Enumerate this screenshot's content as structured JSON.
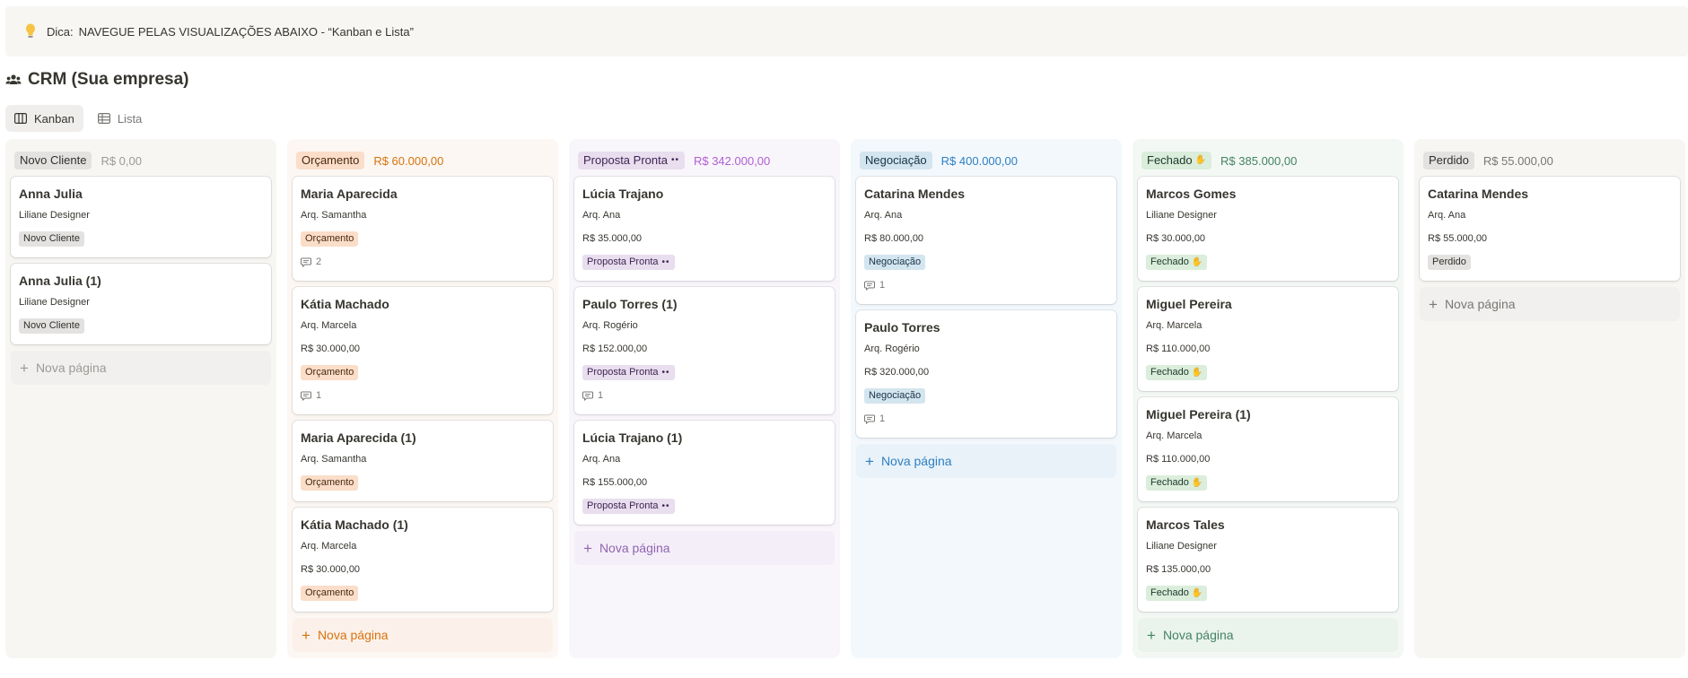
{
  "tip": {
    "label": "Dica:",
    "text": "NAVEGUE PELAS VISUALIZAÇÕES ABAIXO - “Kanban e Lista”"
  },
  "page": {
    "title": "CRM (Sua empresa)"
  },
  "views": [
    {
      "label": "Kanban"
    },
    {
      "label": "Lista"
    }
  ],
  "columns": [
    {
      "label": "Novo Cliente",
      "total": "R$ 0,00",
      "colors": {
        "bg": "#f7f6f3",
        "pill": "#e3e2e0",
        "pill_text": "#32302c",
        "total": "#9b9a97",
        "new": "#9b9a97",
        "newbg": "#f1f0ee"
      },
      "cards": [
        {
          "name": "Anna Julia",
          "sub": "Liliane Designer",
          "tag": "Novo Cliente"
        },
        {
          "name": "Anna Julia (1)",
          "sub": "Liliane Designer",
          "tag": "Novo Cliente"
        }
      ],
      "new_label": "Nova página"
    },
    {
      "label": "Orçamento",
      "total": "R$ 60.000,00",
      "colors": {
        "bg": "#fcf7f3",
        "pill": "#fadec9",
        "pill_text": "#49290e",
        "total": "#d9730d",
        "new": "#d9730d",
        "newbg": "#fbf1ea"
      },
      "cards": [
        {
          "name": "Maria Aparecida",
          "sub": "Arq. Samantha",
          "tag": "Orçamento",
          "comments": "2"
        },
        {
          "name": "Kátia Machado",
          "sub": "Arq. Marcela",
          "value": "R$ 30.000,00",
          "tag": "Orçamento",
          "comments": "1"
        },
        {
          "name": "Maria Aparecida (1)",
          "sub": "Arq. Samantha",
          "tag": "Orçamento"
        },
        {
          "name": "Kátia Machado (1)",
          "sub": "Arq. Marcela",
          "value": "R$ 30.000,00",
          "tag": "Orçamento"
        }
      ],
      "new_label": "Nova página"
    },
    {
      "label": "Proposta Pronta",
      "total": "R$ 342.000,00",
      "colors": {
        "bg": "#f9f6fb",
        "pill": "#e8deee",
        "pill_text": "#412454",
        "total": "#b05ed2",
        "new": "#9065b0",
        "newbg": "#f4eef8"
      },
      "cards": [
        {
          "name": "Lúcia Trajano",
          "sub": "Arq. Ana",
          "value": "R$ 35.000,00",
          "tag": "Proposta Pronta"
        },
        {
          "name": "Paulo Torres (1)",
          "sub": "Arq. Rogério",
          "value": "R$ 152.000,00",
          "tag": "Proposta Pronta",
          "comments": "1"
        },
        {
          "name": "Lúcia Trajano (1)",
          "sub": "Arq. Ana",
          "value": "R$ 155.000,00",
          "tag": "Proposta Pronta"
        }
      ],
      "new_label": "Nova página"
    },
    {
      "label": "Negociação",
      "total": "R$ 400.000,00",
      "colors": {
        "bg": "#f3f8fc",
        "pill": "#d3e5ef",
        "pill_text": "#183347",
        "total": "#2e7fc1",
        "new": "#2e7fc1",
        "newbg": "#e9f2f9"
      },
      "cards": [
        {
          "name": "Catarina Mendes",
          "sub": "Arq. Ana",
          "value": "R$ 80.000,00",
          "tag": "Negociação",
          "comments": "1"
        },
        {
          "name": "Paulo Torres",
          "sub": "Arq. Rogério",
          "value": "R$ 320.000,00",
          "tag": "Negociação",
          "comments": "1"
        }
      ],
      "new_label": "Nova página"
    },
    {
      "label": "Fechado",
      "total": "R$ 385.000,00",
      "colors": {
        "bg": "#f4f8f5",
        "pill": "#dbeddb",
        "pill_text": "#1c3829",
        "total": "#448361",
        "new": "#448361",
        "newbg": "#eaf3ec"
      },
      "cards": [
        {
          "name": "Marcos Gomes",
          "sub": "Liliane Designer",
          "value": "R$ 30.000,00",
          "tag": "Fechado"
        },
        {
          "name": "Miguel Pereira",
          "sub": "Arq. Marcela",
          "value": "R$ 110.000,00",
          "tag": "Fechado"
        },
        {
          "name": "Miguel Pereira (1)",
          "sub": "Arq. Marcela",
          "value": "R$ 110.000,00",
          "tag": "Fechado"
        },
        {
          "name": "Marcos Tales",
          "sub": "Liliane Designer",
          "value": "R$ 135.000,00",
          "tag": "Fechado"
        }
      ],
      "new_label": "Nova página"
    },
    {
      "label": "Perdido",
      "total": "R$ 55.000,00",
      "colors": {
        "bg": "#f7f6f3",
        "pill": "#e3e2e0",
        "pill_text": "#32302c",
        "total": "#787774",
        "new": "#787774",
        "newbg": "#f1f0ee"
      },
      "cards": [
        {
          "name": "Catarina Mendes",
          "sub": "Arq. Ana",
          "value": "R$ 55.000,00",
          "tag": "Perdido"
        }
      ],
      "new_label": "Nova página"
    }
  ]
}
